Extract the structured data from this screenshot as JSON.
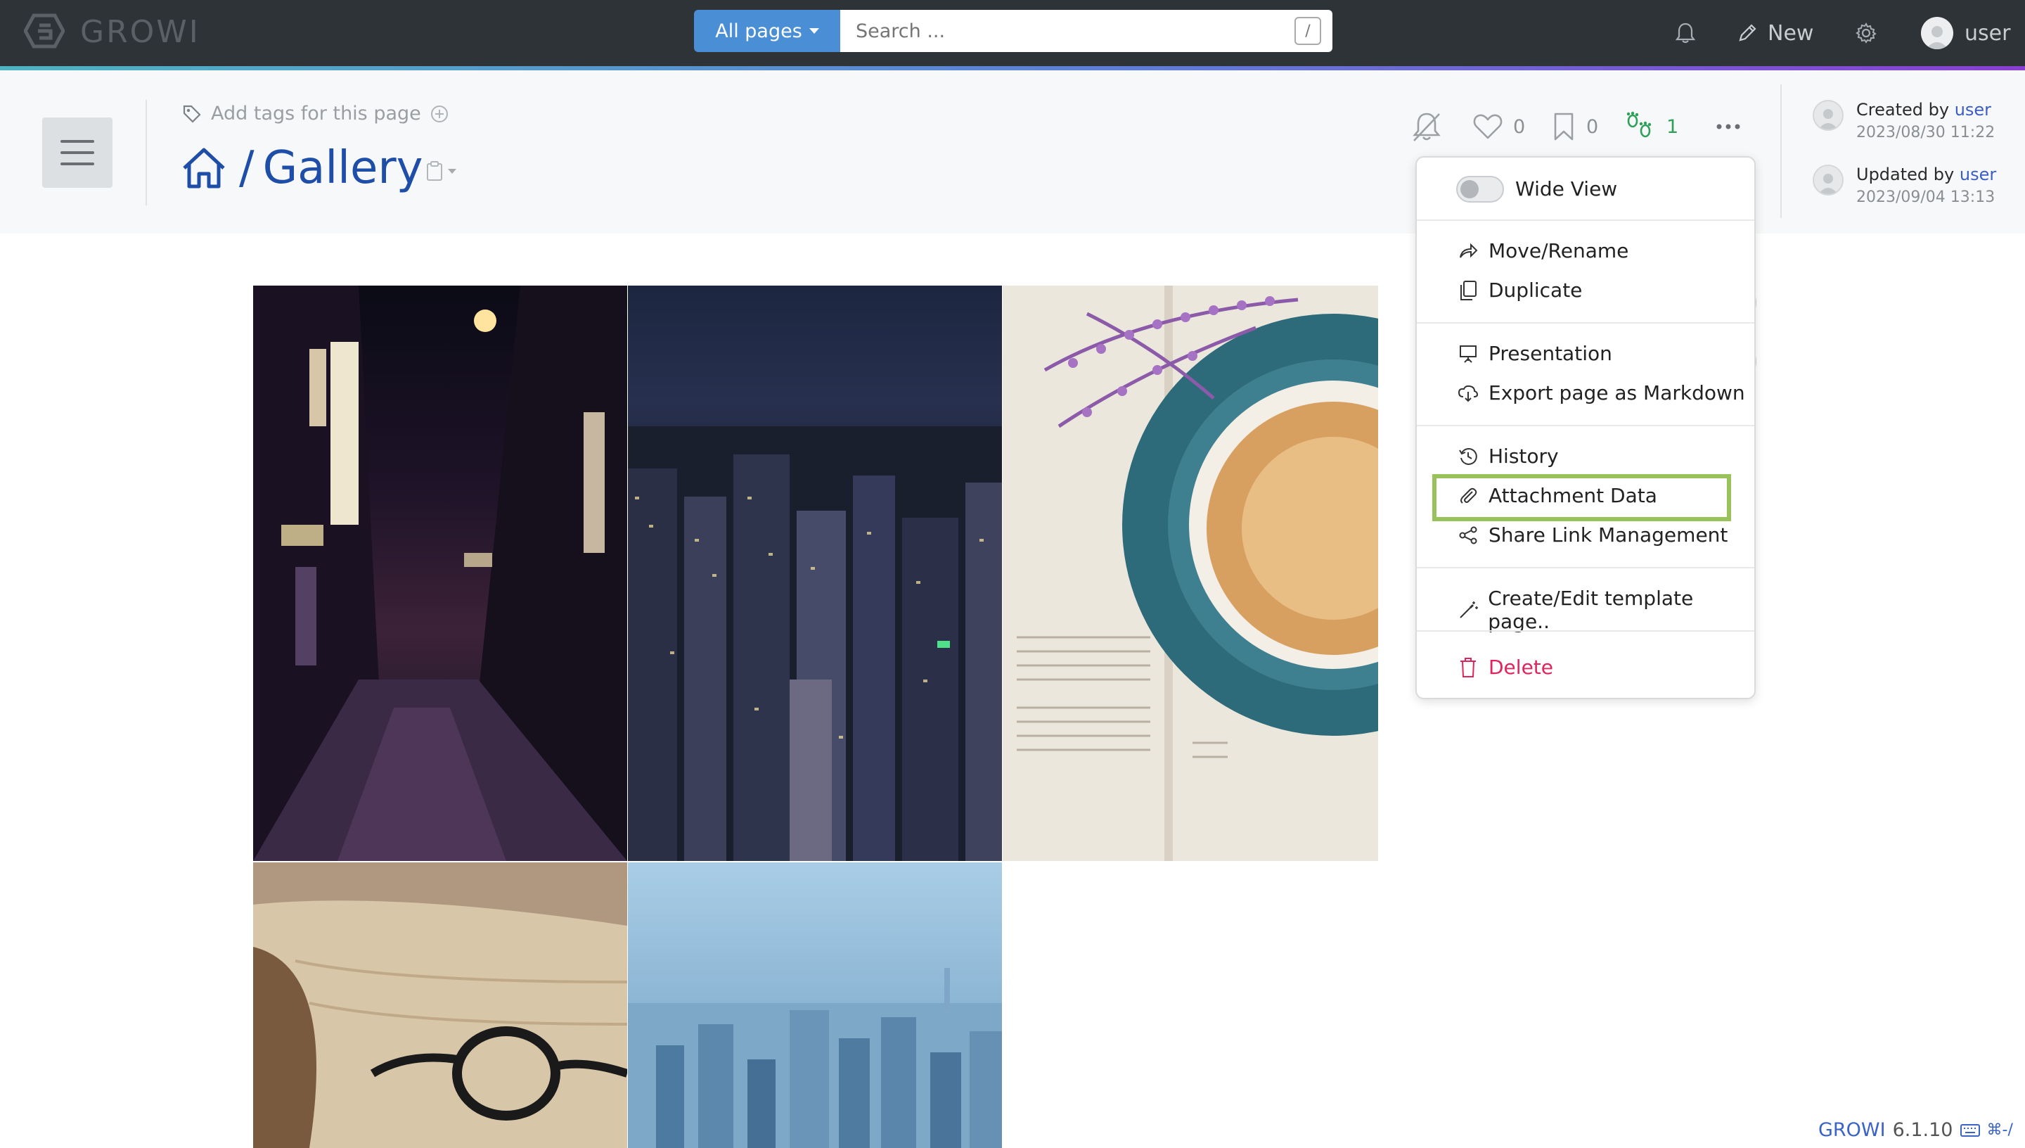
{
  "navbar": {
    "logo_text": "GROWI",
    "search_scope": "All pages",
    "search_placeholder": "Search ...",
    "search_shortcut": "/",
    "new_label": "New",
    "user_label": "user"
  },
  "page": {
    "tags_placeholder": "Add tags for this page",
    "breadcrumb_separator": "/",
    "title": "Gallery",
    "likes_count": "0",
    "bookmarks_count": "0",
    "seen_count": "1",
    "created_by_label": "Created by",
    "created_by_user": "user",
    "created_at": "2023/08/30 11:22",
    "updated_by_label": "Updated by",
    "updated_by_user": "user",
    "updated_at": "2023/09/04 13:13"
  },
  "menu": {
    "wide_view": "Wide View",
    "move_rename": "Move/Rename",
    "duplicate": "Duplicate",
    "presentation": "Presentation",
    "export_markdown": "Export page as Markdown",
    "history": "History",
    "attachment_data": "Attachment Data",
    "share_link": "Share Link Management",
    "template": "Create/Edit template page..",
    "delete": "Delete"
  },
  "gallery": {
    "images": [
      "night-alley",
      "city-night-skyline",
      "coffee-book-flowers",
      "book-glasses",
      "city-day-skyline"
    ]
  },
  "footer": {
    "brand": "GROWI",
    "version": "6.1.10",
    "shortcut_hint": "⌘-/"
  },
  "colors": {
    "navbar": "#2e3338",
    "primary": "#4a8ed6",
    "title": "#1f4ea8",
    "danger": "#e0245e",
    "highlight": "#9ac25a"
  }
}
